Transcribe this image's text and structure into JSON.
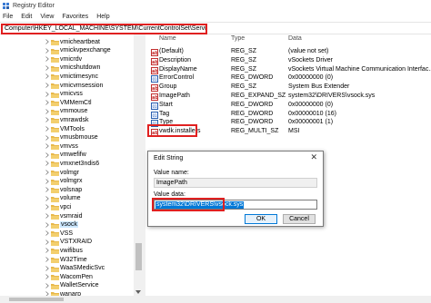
{
  "window": {
    "title": "Registry Editor"
  },
  "menu": [
    "File",
    "Edit",
    "View",
    "Favorites",
    "Help"
  ],
  "address": "Computer\\HKEY_LOCAL_MACHINE\\SYSTEM\\CurrentControlSet\\Services\\vsock",
  "tree": {
    "items": [
      "vmicheartbeat",
      "vmickvpexchange",
      "vmicrdv",
      "vmicshutdown",
      "vmictimesync",
      "vmicvmsession",
      "vmicvss",
      "VMMemCtl",
      "vmmouse",
      "vmrawdsk",
      "VMTools",
      "vmusbmouse",
      "vmvss",
      "vmwefifw",
      "vmxnet3ndis6",
      "volmgr",
      "volmgrx",
      "volsnap",
      "volume",
      "vpci",
      "vsmraid",
      "vsock",
      "VSS",
      "VSTXRAID",
      "vwifibus",
      "W32Time",
      "WaaSMedicSvc",
      "WacomPen",
      "WalletService",
      "wanarp"
    ],
    "selected": "vsock"
  },
  "columns": {
    "name": "Name",
    "type": "Type",
    "data": "Data"
  },
  "values": [
    {
      "icon": "string",
      "name": "(Default)",
      "type": "REG_SZ",
      "data": "(value not set)"
    },
    {
      "icon": "string",
      "name": "Description",
      "type": "REG_SZ",
      "data": "vSockets Driver"
    },
    {
      "icon": "string",
      "name": "DisplayName",
      "type": "REG_SZ",
      "data": "vSockets Virtual Machine Communication Interfac..."
    },
    {
      "icon": "binary",
      "name": "ErrorControl",
      "type": "REG_DWORD",
      "data": "0x00000000 (0)"
    },
    {
      "icon": "string",
      "name": "Group",
      "type": "REG_SZ",
      "data": "System Bus Extender"
    },
    {
      "icon": "string",
      "name": "ImagePath",
      "type": "REG_EXPAND_SZ",
      "data": "system32\\DRIVERS\\vsock.sys"
    },
    {
      "icon": "binary",
      "name": "Start",
      "type": "REG_DWORD",
      "data": "0x00000000 (0)"
    },
    {
      "icon": "binary",
      "name": "Tag",
      "type": "REG_DWORD",
      "data": "0x00000010 (16)"
    },
    {
      "icon": "binary",
      "name": "Type",
      "type": "REG_DWORD",
      "data": "0x00000001 (1)"
    },
    {
      "icon": "string",
      "name": "vwdk.installers",
      "type": "REG_MULTI_SZ",
      "data": "MSI"
    }
  ],
  "dialog": {
    "title": "Edit String",
    "close": "✕",
    "value_name_label": "Value name:",
    "value_name": "ImagePath",
    "value_data_label": "Value data:",
    "value_data": "system32\\DRIVERS\\vsock.sys",
    "ok_label": "OK",
    "cancel_label": "Cancel"
  },
  "colors": {
    "highlight": "#e02020",
    "selection": "#0078d7",
    "folder": "#e8b84a"
  }
}
